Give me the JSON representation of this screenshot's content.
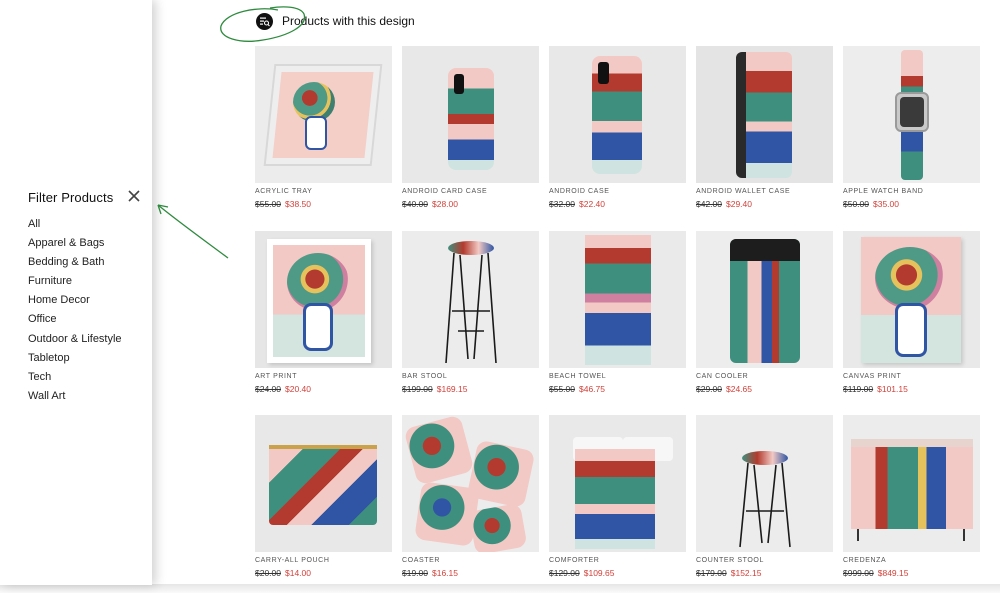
{
  "header": {
    "title": "Products with this design",
    "icon": "product-filter-icon"
  },
  "filter": {
    "title": "Filter Products",
    "close_icon": "close-icon",
    "categories": [
      "All",
      "Apparel & Bags",
      "Bedding & Bath",
      "Furniture",
      "Home Decor",
      "Office",
      "Outdoor & Lifestyle",
      "Tabletop",
      "Tech",
      "Wall Art"
    ]
  },
  "products": [
    {
      "name": "ACRYLIC TRAY",
      "old_price": "$55.00",
      "new_price": "$38.50",
      "kind": "tray"
    },
    {
      "name": "ANDROID CARD CASE",
      "old_price": "$40.00",
      "new_price": "$28.00",
      "kind": "phone"
    },
    {
      "name": "ANDROID CASE",
      "old_price": "$32.00",
      "new_price": "$22.40",
      "kind": "phone"
    },
    {
      "name": "ANDROID WALLET CASE",
      "old_price": "$42.00",
      "new_price": "$29.40",
      "kind": "wallet"
    },
    {
      "name": "APPLE WATCH BAND",
      "old_price": "$50.00",
      "new_price": "$35.00",
      "kind": "watch"
    },
    {
      "name": "ART PRINT",
      "old_price": "$24.00",
      "new_price": "$20.40",
      "kind": "print"
    },
    {
      "name": "BAR STOOL",
      "old_price": "$199.00",
      "new_price": "$169.15",
      "kind": "stool"
    },
    {
      "name": "BEACH TOWEL",
      "old_price": "$55.00",
      "new_price": "$46.75",
      "kind": "towel"
    },
    {
      "name": "CAN COOLER",
      "old_price": "$29.00",
      "new_price": "$24.65",
      "kind": "can"
    },
    {
      "name": "CANVAS PRINT",
      "old_price": "$119.00",
      "new_price": "$101.15",
      "kind": "canvas"
    },
    {
      "name": "CARRY-ALL POUCH",
      "old_price": "$20.00",
      "new_price": "$14.00",
      "kind": "pouch"
    },
    {
      "name": "COASTER",
      "old_price": "$19.00",
      "new_price": "$16.15",
      "kind": "coaster"
    },
    {
      "name": "COMFORTER",
      "old_price": "$129.00",
      "new_price": "$109.65",
      "kind": "comforter"
    },
    {
      "name": "COUNTER STOOL",
      "old_price": "$179.00",
      "new_price": "$152.15",
      "kind": "stool2"
    },
    {
      "name": "CREDENZA",
      "old_price": "$999.00",
      "new_price": "$849.15",
      "kind": "credenza"
    }
  ],
  "colors": {
    "sale": "#d2413a",
    "annotation": "#2e8b3e",
    "pink": "#f2c9c4",
    "teal": "#3f8f7e",
    "blue": "#2f55a4"
  }
}
